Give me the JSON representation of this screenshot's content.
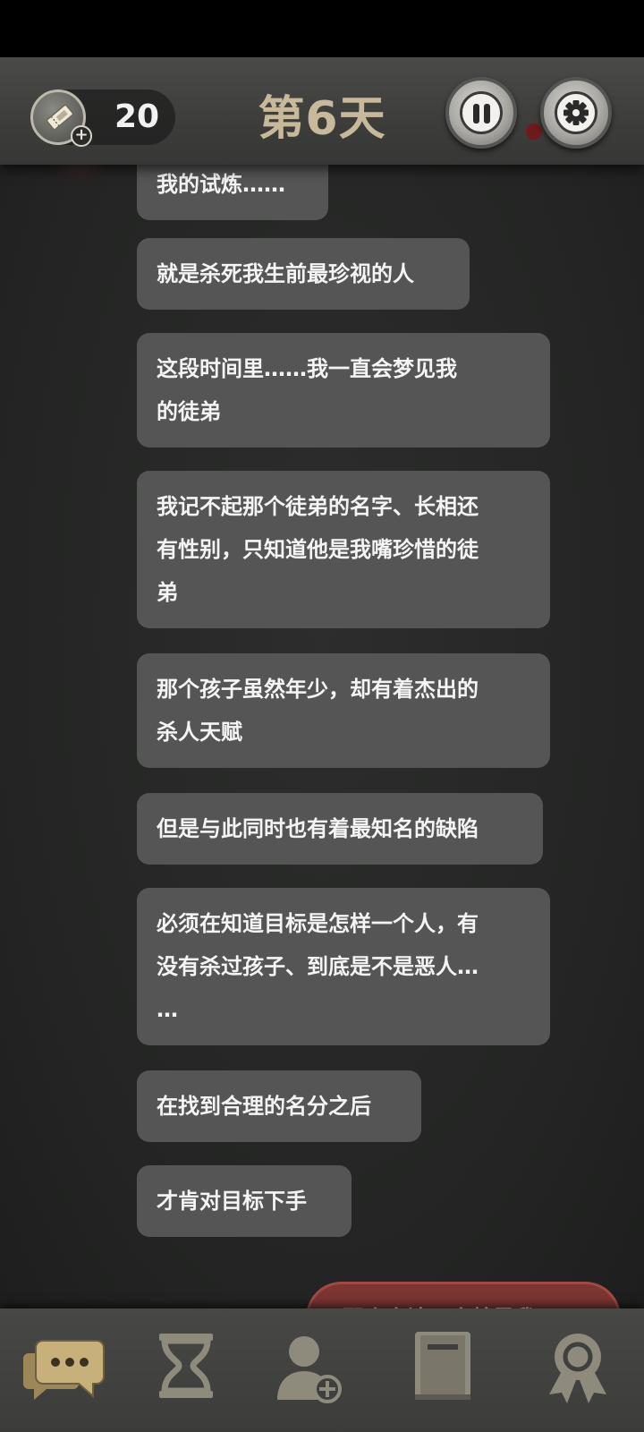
{
  "header": {
    "ticket_count": "20",
    "day_title": "第6天"
  },
  "messages": [
    "我的试炼……",
    "就是杀死我生前最珍视的人",
    "这段时间里……我一直会梦见我\n的徒弟",
    "我记不起那个徒弟的名字、长相还\n有性别，只知道他是我嘴珍惜的徒\n弟",
    "那个孩子虽然年少，却有着杰出的\n杀人天赋",
    "但是与此同时也有着最知名的缺陷",
    "必须在知道目标是怎样一个人，有\n没有杀过孩子、到底是不是恶人…\n…",
    "在找到合理的名分之后",
    "才肯对目标下手"
  ],
  "reply": {
    "text": "那个人该不会就是我？"
  },
  "nav": {
    "items": [
      "chat-icon",
      "hourglass-icon",
      "add-contact-icon",
      "book-icon",
      "badge-icon"
    ],
    "active_color": "#c7b07a",
    "inactive_color": "#8e8a7c"
  }
}
